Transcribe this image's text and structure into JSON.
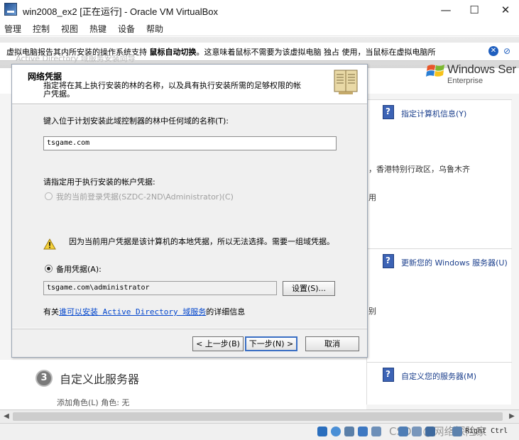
{
  "window": {
    "title": "win2008_ex2 [正在运行] - Oracle VM VirtualBox",
    "min": "—",
    "max": "☐",
    "close": "✕"
  },
  "menu": [
    "管理",
    "控制",
    "视图",
    "热键",
    "设备",
    "帮助"
  ],
  "notification": {
    "text_before": "虚拟电脑报告其内所安装的操作系统支持 ",
    "bold": "鼠标自动切换",
    "text_after": "。这意味着鼠标不需要为该虚拟电脑 独占 使用，当鼠标在虚拟电脑所",
    "faded_title": "Active Directory 域服务安装向导"
  },
  "guest_bg": {
    "logo_text": "Windows Ser",
    "logo_sub": "Enterprise",
    "right_links": [
      "指定计算机信息(Y)",
      "更新您的 Windows 服务器(U)",
      "自定义您的服务器(M)"
    ],
    "right_texts": [
      "，香港特别行政区，乌鲁木齐",
      "用",
      "别"
    ],
    "step3_num": "3",
    "step3_title": "自定义此服务器",
    "partial_row": "添加角色(L)        角色:             无"
  },
  "wizard": {
    "title": "网络凭据",
    "subtitle": "指定将在其上执行安装的林的名称，以及具有执行安装所需的足够权限的帐户凭据。",
    "domain_label": "键入位于计划安装此域控制器的林中任何域的名称(T):",
    "domain_value": "tsgame.com",
    "cred_label": "请指定用于执行安装的帐户凭据:",
    "current_cred": "我的当前登录凭据(SZDC-2ND\\Administrator)(C)",
    "warning": "因为当前用户凭据是该计算机的本地凭据，所以无法选择。需要一组域凭据。",
    "alt_cred": "备用凭据(A):",
    "alt_value": "tsgame.com\\administrator",
    "set_button": "设置(S)...",
    "link_prefix": "有关",
    "link_text": "谁可以安装 Active Directory 域服务",
    "link_suffix": "的详细信息",
    "back_button": "< 上一步(B)",
    "next_button": "下一步(N) >",
    "cancel_button": "取消"
  },
  "status": {
    "right_ctrl": "Right Ctrl",
    "watermark": "CSDN @网络探险家"
  }
}
